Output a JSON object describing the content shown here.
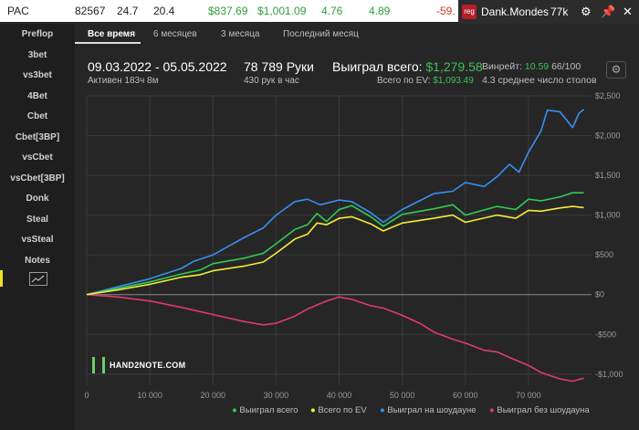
{
  "topbar": {
    "site": "PAC",
    "hands": "82567",
    "vpip": "24.7",
    "pfr": "20.4",
    "won": "$837.69",
    "ev": "$1,001.09",
    "bb1": "4.76",
    "bb2": "4.89",
    "neg": "-59."
  },
  "player": {
    "badge": "reg",
    "name": "Dank.Mondes",
    "hands": "77k"
  },
  "sidebar": {
    "items": [
      "Preflop",
      "3bet",
      "vs3bet",
      "4Bet",
      "Cbet",
      "Cbet[3BP]",
      "vsCbet",
      "vsCbet[3BP]",
      "Donk",
      "Steal",
      "vsSteal",
      "Notes"
    ]
  },
  "tabs": [
    "Все время",
    "6 месяцев",
    "3 месяца",
    "Последний месяц"
  ],
  "stats": {
    "date_range": "09.03.2022 - 05.05.2022",
    "active": "Активен 183ч 8м",
    "hands_label": "78 789 Руки",
    "hands_per_hour": "430 рук в час",
    "won_label": "Выиграл всего:",
    "won_value": "$1,279.58",
    "ev_label": "Всего по EV:",
    "ev_value": "$1,093.49",
    "winrate_label": "Винрейт:",
    "winrate_value": "10.59",
    "winrate_rest": "66/100",
    "tables": "4.3 среднее число столов"
  },
  "logo": "HAND2NOTE.COM",
  "colors": {
    "won": "#2ecc55",
    "ev": "#f2ee3a",
    "showdown": "#3a8ff0",
    "nonshowdown": "#e23a6e",
    "accent_green": "#3fbf5a"
  },
  "chart_data": {
    "type": "line",
    "x_ticks": [
      "0",
      "10 000",
      "20 000",
      "30 000",
      "40 000",
      "50 000",
      "60 000",
      "70 000"
    ],
    "y_ticks": [
      "$2,500",
      "$2,000",
      "$1,500",
      "$1,000",
      "$500",
      "$0",
      "-$500",
      "-$1,000"
    ],
    "xlim": [
      0,
      80000
    ],
    "ylim": [
      -1140,
      2500
    ],
    "series": [
      {
        "name": "Выиграл всего",
        "key": "won",
        "x": [
          0,
          5000,
          10000,
          15000,
          18000,
          20000,
          25000,
          28000,
          30000,
          33000,
          35000,
          36500,
          38000,
          40000,
          42000,
          45000,
          47000,
          50000,
          55000,
          58000,
          60000,
          65000,
          68000,
          70000,
          72000,
          75000,
          77000,
          78789
        ],
        "y": [
          0,
          80,
          160,
          260,
          310,
          390,
          460,
          520,
          640,
          820,
          880,
          1020,
          920,
          1070,
          1120,
          980,
          860,
          1010,
          1080,
          1130,
          1000,
          1110,
          1070,
          1200,
          1180,
          1230,
          1280,
          1280
        ]
      },
      {
        "name": "Всего по EV",
        "key": "ev",
        "x": [
          0,
          5000,
          10000,
          15000,
          18000,
          20000,
          25000,
          28000,
          30000,
          33000,
          35000,
          36500,
          38000,
          40000,
          42000,
          45000,
          47000,
          50000,
          55000,
          58000,
          60000,
          65000,
          68000,
          70000,
          72000,
          75000,
          77000,
          78789
        ],
        "y": [
          0,
          60,
          130,
          220,
          250,
          300,
          360,
          410,
          520,
          700,
          760,
          900,
          880,
          960,
          980,
          890,
          800,
          900,
          960,
          1000,
          910,
          1000,
          960,
          1060,
          1050,
          1090,
          1110,
          1093
        ]
      },
      {
        "name": "Выиграл на шоудауне",
        "key": "showdown",
        "x": [
          0,
          5000,
          10000,
          15000,
          17000,
          20000,
          25000,
          28000,
          30000,
          33000,
          35000,
          37000,
          40000,
          42000,
          45000,
          47000,
          50000,
          55000,
          58000,
          60000,
          63000,
          65000,
          67000,
          68500,
          70000,
          72000,
          73000,
          75000,
          77000,
          78000,
          78789
        ],
        "y": [
          0,
          100,
          200,
          330,
          420,
          500,
          720,
          840,
          1000,
          1170,
          1200,
          1130,
          1190,
          1170,
          1030,
          910,
          1070,
          1270,
          1300,
          1410,
          1360,
          1480,
          1640,
          1540,
          1790,
          2060,
          2320,
          2300,
          2100,
          2280,
          2330
        ]
      },
      {
        "name": "Выиграл без шоудауна",
        "key": "nonshowdown",
        "x": [
          0,
          5000,
          10000,
          15000,
          20000,
          25000,
          28000,
          30000,
          33000,
          35000,
          38000,
          40000,
          42000,
          45000,
          47000,
          50000,
          53000,
          55000,
          58000,
          60000,
          63000,
          65000,
          67000,
          70000,
          72000,
          75000,
          77000,
          78789
        ],
        "y": [
          0,
          -30,
          -80,
          -160,
          -250,
          -340,
          -380,
          -360,
          -270,
          -180,
          -80,
          -30,
          -60,
          -140,
          -170,
          -260,
          -370,
          -470,
          -560,
          -610,
          -700,
          -720,
          -790,
          -890,
          -980,
          -1060,
          -1090,
          -1050
        ]
      }
    ]
  }
}
